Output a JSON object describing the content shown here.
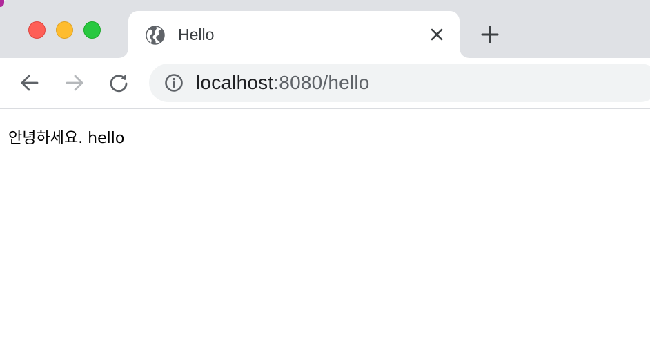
{
  "window": {
    "controls": [
      "close",
      "minimize",
      "zoom"
    ]
  },
  "tab": {
    "title": "Hello",
    "favicon": "globe-icon",
    "close_icon": "close-icon"
  },
  "new_tab_icon": "plus-icon",
  "toolbar": {
    "back_icon": "arrow-left-icon",
    "forward_icon": "arrow-right-icon",
    "reload_icon": "reload-icon",
    "forward_enabled": false
  },
  "omnibox": {
    "site_info_icon": "info-icon",
    "url_host": "localhost",
    "url_rest": ":8080/hello"
  },
  "page": {
    "body_text": "안녕하세요. hello"
  },
  "colors": {
    "tabstrip": "#dfe1e5",
    "omnibox": "#f1f3f4",
    "close_light": "#fe5f57",
    "minimize_light": "#febc2e",
    "zoom_light": "#28c840"
  }
}
